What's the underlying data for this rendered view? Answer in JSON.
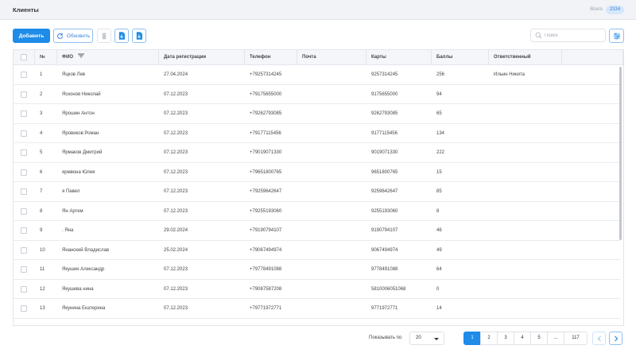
{
  "header": {
    "title": "Клиенты",
    "total_label": "Всего",
    "total_count": "2334"
  },
  "toolbar": {
    "add_label": "Добавить",
    "refresh_label": "Обновить",
    "delete_icon": "trash-icon",
    "export_icons": [
      "export-file-icon",
      "export-file-icon"
    ],
    "filter_settings_icon": "sliders-icon"
  },
  "search": {
    "placeholder": "Поиск",
    "value": ""
  },
  "table": {
    "columns": [
      "№",
      "ФИО",
      "Дата регистрации",
      "Телефон",
      "Почта",
      "Карты",
      "Баллы",
      "Ответственный"
    ],
    "rows": [
      {
        "num": "1",
        "name": "Яцков Лев",
        "date": "27.04.2024",
        "phone": "+79257314245",
        "email": "",
        "card": "9257314245",
        "points": "256",
        "manager": "Ильин Никита"
      },
      {
        "num": "2",
        "name": "Ясконов Николай",
        "date": "07.12.2023",
        "phone": "+79175655000",
        "email": "",
        "card": "9175655000",
        "points": "94",
        "manager": ""
      },
      {
        "num": "3",
        "name": "Ярошин Антон",
        "date": "07.12.2023",
        "phone": "+79262793085",
        "email": "",
        "card": "9262793085",
        "points": "65",
        "manager": ""
      },
      {
        "num": "4",
        "name": "Яровиков Роман",
        "date": "07.12.2023",
        "phone": "+79177115456",
        "email": "",
        "card": "9177115456",
        "points": "134",
        "manager": ""
      },
      {
        "num": "5",
        "name": "Ярмаков Дмитрий",
        "date": "07.12.2023",
        "phone": "+79019071330",
        "email": "",
        "card": "9019071330",
        "points": "222",
        "manager": ""
      },
      {
        "num": "6",
        "name": "ярмвона Юлия",
        "date": "07.12.2023",
        "phone": "+79651800765",
        "email": "",
        "card": "9651800765",
        "points": "15",
        "manager": ""
      },
      {
        "num": "7",
        "name": "я Павел",
        "date": "07.12.2023",
        "phone": "+79259642647",
        "email": "",
        "card": "9259642647",
        "points": "85",
        "manager": ""
      },
      {
        "num": "8",
        "name": "Ян Артем",
        "date": "07.12.2023",
        "phone": "+79255193060",
        "email": "",
        "card": "9255193060",
        "points": "8",
        "manager": ""
      },
      {
        "num": "9",
        "name": ". Яна",
        "date": "29.02.2024",
        "phone": "+79190794107",
        "email": "",
        "card": "9190794107",
        "points": "46",
        "manager": ""
      },
      {
        "num": "10",
        "name": "Янанский Владислав",
        "date": "25.02.2024",
        "phone": "+79067494974",
        "email": "",
        "card": "9067494974",
        "points": "49",
        "manager": ""
      },
      {
        "num": "11",
        "name": "Якушин Александр",
        "date": "07.12.2023",
        "phone": "+79778491088",
        "email": "",
        "card": "9778491088",
        "points": "64",
        "manager": ""
      },
      {
        "num": "12",
        "name": "Якушева нина",
        "date": "07.12.2023",
        "phone": "+79087587208",
        "email": "",
        "card": "5810006051068",
        "points": "0",
        "manager": ""
      },
      {
        "num": "13",
        "name": "Якунина Екатерина",
        "date": "07.12.2023",
        "phone": "+79771972771",
        "email": "",
        "card": "9771972771",
        "points": "14",
        "manager": ""
      }
    ]
  },
  "pagination": {
    "per_page_label": "Показывать по",
    "per_page_value": "20",
    "pages": [
      "1",
      "2",
      "3",
      "4",
      "5",
      "...",
      "117"
    ],
    "current_page": "1"
  },
  "colors": {
    "primary": "#1e8ce8",
    "badge_bg": "#d6e8fb",
    "header_bg": "#f2f3f7"
  }
}
